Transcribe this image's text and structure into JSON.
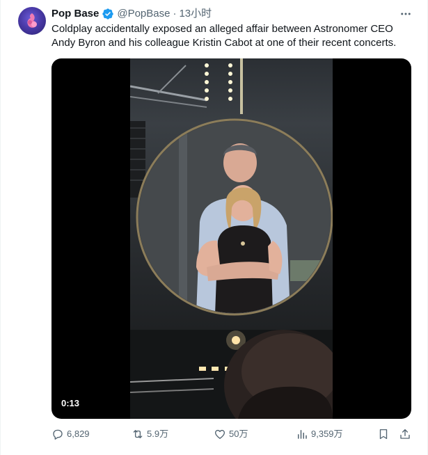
{
  "post": {
    "author_name": "Pop Base",
    "author_handle": "@PopBase",
    "separator": "·",
    "timestamp": "13小时",
    "text": "Coldplay accidentally exposed an alleged affair between Astronomer CEO Andy Byron and his colleague Kristin Cabot at one of their recent concerts.",
    "verified": true,
    "accent_color": "#1d9bf0"
  },
  "media": {
    "type": "video",
    "duration": "0:13"
  },
  "actions": {
    "replies": "6,829",
    "reposts": "5.9万",
    "likes": "50万",
    "views": "9,359万"
  },
  "icons": {
    "more": "more-dots-icon",
    "reply": "reply-bubble-icon",
    "repost": "repost-arrows-icon",
    "like": "heart-icon",
    "views": "bar-chart-icon",
    "bookmark": "bookmark-icon",
    "share": "share-upload-icon"
  }
}
